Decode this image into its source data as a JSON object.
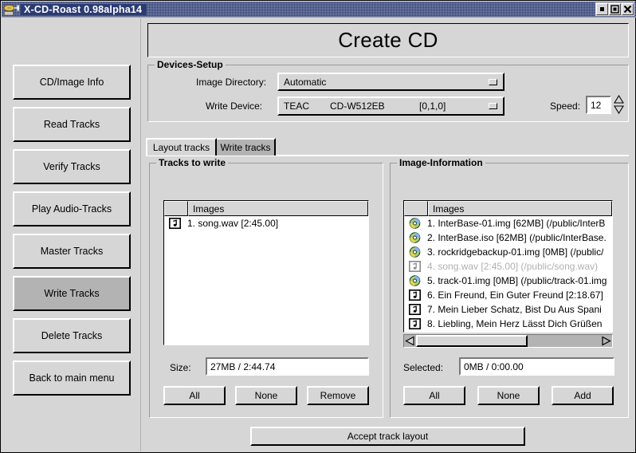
{
  "window": {
    "title": "X-CD-Roast 0.98alpha14",
    "icon": "cd-disc-pin-icon",
    "buttons": [
      {
        "name": "minimize-button",
        "glyph": "minimize-icon"
      },
      {
        "name": "maximize-button",
        "glyph": "maximize-icon"
      },
      {
        "name": "close-button",
        "glyph": "close-icon"
      }
    ]
  },
  "sidebar": {
    "items": [
      {
        "label": "CD/Image Info",
        "active": false
      },
      {
        "label": "Read Tracks",
        "active": false
      },
      {
        "label": "Verify Tracks",
        "active": false
      },
      {
        "label": "Play Audio-Tracks",
        "active": false
      },
      {
        "label": "Master Tracks",
        "active": false
      },
      {
        "label": "Write Tracks",
        "active": true
      },
      {
        "label": "Delete Tracks",
        "active": false
      },
      {
        "label": "Back to main menu",
        "active": false
      }
    ]
  },
  "header": {
    "title": "Create CD"
  },
  "devices_setup": {
    "legend": "Devices-Setup",
    "image_directory": {
      "label": "Image Directory:",
      "value": "Automatic"
    },
    "write_device": {
      "label": "Write Device:",
      "vendor": "TEAC",
      "model": "CD-W512EB",
      "address": "[0,1,0]"
    },
    "speed": {
      "label": "Speed:",
      "value": "12"
    }
  },
  "tabs": [
    {
      "label": "Layout tracks",
      "active": true
    },
    {
      "label": "Write tracks",
      "active": false
    }
  ],
  "tracks_to_write": {
    "legend": "Tracks to write",
    "column_header": "Images",
    "rows": [
      {
        "icon": "audio-note-icon",
        "text": "1. song.wav [2:45.00]",
        "disabled": false
      }
    ],
    "size": {
      "label": "Size:",
      "value": "27MB / 2:44.74"
    },
    "buttons": [
      {
        "label": "All"
      },
      {
        "label": "None"
      },
      {
        "label": "Remove"
      }
    ]
  },
  "image_information": {
    "legend": "Image-Information",
    "column_header": "Images",
    "rows": [
      {
        "icon": "cd-disc-icon",
        "text": "1. InterBase-01.img [62MB] (/public/InterB",
        "disabled": false
      },
      {
        "icon": "cd-disc-icon",
        "text": "2. InterBase.iso [62MB] (/public/InterBase.",
        "disabled": false
      },
      {
        "icon": "cd-disc-icon",
        "text": "3. rockridgebackup-01.img [0MB] (/public/",
        "disabled": false
      },
      {
        "icon": "audio-note-icon",
        "text": "4. song.wav [2:45.00] (/public/song.wav)",
        "disabled": true
      },
      {
        "icon": "cd-disc-icon",
        "text": "5. track-01.img [0MB] (/public/track-01.img",
        "disabled": false
      },
      {
        "icon": "audio-note-icon",
        "text": "6. Ein Freund, Ein Guter Freund [2:18.67]",
        "disabled": false
      },
      {
        "icon": "audio-note-icon",
        "text": "7. Mein Lieber Schatz, Bist Du Aus Spani",
        "disabled": false
      },
      {
        "icon": "audio-note-icon",
        "text": "8. Liebling, Mein Herz Lässt Dich Grüßen",
        "disabled": false
      }
    ],
    "selected": {
      "label": "Selected:",
      "value": "0MB / 0:00.00"
    },
    "buttons": [
      {
        "label": "All"
      },
      {
        "label": "None"
      },
      {
        "label": "Add"
      }
    ]
  },
  "accept": {
    "label": "Accept track layout"
  },
  "colors": {
    "titlebar": "#2b3b72",
    "face": "#d6d6d6",
    "active_button": "#b3b3b3",
    "list_bg": "#ffffff",
    "disabled_text": "#b0b0b0"
  }
}
